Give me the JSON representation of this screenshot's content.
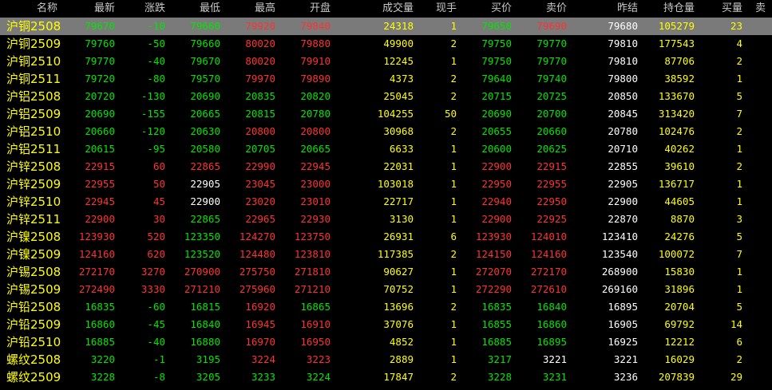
{
  "header": {
    "name": "名称",
    "last": "最新",
    "change": "涨跌",
    "low": "最低",
    "high": "最高",
    "open": "开盘",
    "volume": "成交量",
    "current_hand": "现手",
    "bid": "买价",
    "ask": "卖价",
    "prev_settle": "昨结",
    "open_interest": "持仓量",
    "bid_vol": "买量",
    "ask_vol": "卖"
  },
  "colors": {
    "up": "#ff3232",
    "down": "#00e600",
    "flat": "#ffffff",
    "name": "#ffff00",
    "volume": "#ffff00",
    "selected_row_bg": "#7a7a7a"
  },
  "selected_row": 0,
  "rows": [
    {
      "name": "沪铜2508",
      "last": "79670",
      "chg": "-10",
      "low": "79660",
      "high": "79920",
      "open": "79840",
      "vol": "24318",
      "cur": "1",
      "bid": "79650",
      "ask": "79690",
      "pre": "79680",
      "oi": "105279",
      "bidvol": "23",
      "c": {
        "last": "down",
        "chg": "down",
        "low": "down",
        "high": "up",
        "open": "up",
        "bid": "down",
        "ask": "up"
      }
    },
    {
      "name": "沪铜2509",
      "last": "79760",
      "chg": "-50",
      "low": "79660",
      "high": "80020",
      "open": "79880",
      "vol": "49900",
      "cur": "2",
      "bid": "79750",
      "ask": "79770",
      "pre": "79810",
      "oi": "177543",
      "bidvol": "4",
      "c": {
        "last": "down",
        "chg": "down",
        "low": "down",
        "high": "up",
        "open": "up",
        "bid": "down",
        "ask": "down"
      }
    },
    {
      "name": "沪铜2510",
      "last": "79770",
      "chg": "-40",
      "low": "79670",
      "high": "80020",
      "open": "79910",
      "vol": "12245",
      "cur": "1",
      "bid": "79750",
      "ask": "79770",
      "pre": "79810",
      "oi": "87706",
      "bidvol": "2",
      "c": {
        "last": "down",
        "chg": "down",
        "low": "down",
        "high": "up",
        "open": "up",
        "bid": "down",
        "ask": "down"
      }
    },
    {
      "name": "沪铜2511",
      "last": "79720",
      "chg": "-80",
      "low": "79570",
      "high": "79970",
      "open": "79890",
      "vol": "4373",
      "cur": "2",
      "bid": "79640",
      "ask": "79740",
      "pre": "79800",
      "oi": "38592",
      "bidvol": "1",
      "c": {
        "last": "down",
        "chg": "down",
        "low": "down",
        "high": "up",
        "open": "up",
        "bid": "down",
        "ask": "down"
      }
    },
    {
      "name": "沪铝2508",
      "last": "20720",
      "chg": "-130",
      "low": "20690",
      "high": "20835",
      "open": "20820",
      "vol": "25045",
      "cur": "2",
      "bid": "20715",
      "ask": "20725",
      "pre": "20850",
      "oi": "133670",
      "bidvol": "5",
      "c": {
        "last": "down",
        "chg": "down",
        "low": "down",
        "high": "down",
        "open": "down",
        "bid": "down",
        "ask": "down"
      }
    },
    {
      "name": "沪铝2509",
      "last": "20690",
      "chg": "-155",
      "low": "20665",
      "high": "20815",
      "open": "20780",
      "vol": "104255",
      "cur": "50",
      "bid": "20690",
      "ask": "20700",
      "pre": "20845",
      "oi": "313420",
      "bidvol": "7",
      "c": {
        "last": "down",
        "chg": "down",
        "low": "down",
        "high": "down",
        "open": "down",
        "bid": "down",
        "ask": "down"
      }
    },
    {
      "name": "沪铝2510",
      "last": "20660",
      "chg": "-120",
      "low": "20630",
      "high": "20800",
      "open": "20800",
      "vol": "30968",
      "cur": "2",
      "bid": "20655",
      "ask": "20660",
      "pre": "20780",
      "oi": "102476",
      "bidvol": "2",
      "c": {
        "last": "down",
        "chg": "down",
        "low": "down",
        "high": "up",
        "open": "up",
        "bid": "down",
        "ask": "down"
      }
    },
    {
      "name": "沪铝2511",
      "last": "20615",
      "chg": "-95",
      "low": "20580",
      "high": "20705",
      "open": "20665",
      "vol": "6633",
      "cur": "1",
      "bid": "20600",
      "ask": "20625",
      "pre": "20710",
      "oi": "40262",
      "bidvol": "1",
      "c": {
        "last": "down",
        "chg": "down",
        "low": "down",
        "high": "down",
        "open": "down",
        "bid": "down",
        "ask": "down"
      }
    },
    {
      "name": "沪锌2508",
      "last": "22915",
      "chg": "60",
      "low": "22865",
      "high": "22990",
      "open": "22945",
      "vol": "22031",
      "cur": "1",
      "bid": "22900",
      "ask": "22915",
      "pre": "22855",
      "oi": "39610",
      "bidvol": "2",
      "c": {
        "last": "up",
        "chg": "up",
        "low": "up",
        "high": "up",
        "open": "up",
        "bid": "up",
        "ask": "up"
      }
    },
    {
      "name": "沪锌2509",
      "last": "22955",
      "chg": "50",
      "low": "22905",
      "high": "23045",
      "open": "23000",
      "vol": "103018",
      "cur": "1",
      "bid": "22950",
      "ask": "22955",
      "pre": "22905",
      "oi": "136717",
      "bidvol": "1",
      "c": {
        "last": "up",
        "chg": "up",
        "low": "flat",
        "high": "up",
        "open": "up",
        "bid": "up",
        "ask": "up"
      }
    },
    {
      "name": "沪锌2510",
      "last": "22945",
      "chg": "45",
      "low": "22900",
      "high": "23020",
      "open": "23010",
      "vol": "22717",
      "cur": "1",
      "bid": "22940",
      "ask": "22950",
      "pre": "22900",
      "oi": "44605",
      "bidvol": "1",
      "c": {
        "last": "up",
        "chg": "up",
        "low": "flat",
        "high": "up",
        "open": "up",
        "bid": "up",
        "ask": "up"
      }
    },
    {
      "name": "沪锌2511",
      "last": "22900",
      "chg": "30",
      "low": "22865",
      "high": "22965",
      "open": "22930",
      "vol": "3130",
      "cur": "1",
      "bid": "22900",
      "ask": "22925",
      "pre": "22870",
      "oi": "8870",
      "bidvol": "3",
      "c": {
        "last": "up",
        "chg": "up",
        "low": "down",
        "high": "up",
        "open": "up",
        "bid": "up",
        "ask": "up"
      }
    },
    {
      "name": "沪镍2508",
      "last": "123930",
      "chg": "520",
      "low": "123350",
      "high": "124270",
      "open": "123750",
      "vol": "26931",
      "cur": "6",
      "bid": "123930",
      "ask": "124010",
      "pre": "123410",
      "oi": "24276",
      "bidvol": "5",
      "c": {
        "last": "up",
        "chg": "up",
        "low": "down",
        "high": "up",
        "open": "up",
        "bid": "up",
        "ask": "up"
      }
    },
    {
      "name": "沪镍2509",
      "last": "124160",
      "chg": "620",
      "low": "123520",
      "high": "124480",
      "open": "123810",
      "vol": "117385",
      "cur": "2",
      "bid": "124150",
      "ask": "124160",
      "pre": "123540",
      "oi": "100072",
      "bidvol": "7",
      "c": {
        "last": "up",
        "chg": "up",
        "low": "down",
        "high": "up",
        "open": "up",
        "bid": "up",
        "ask": "up"
      }
    },
    {
      "name": "沪锡2508",
      "last": "272170",
      "chg": "3270",
      "low": "270900",
      "high": "275750",
      "open": "271810",
      "vol": "90627",
      "cur": "1",
      "bid": "272070",
      "ask": "272170",
      "pre": "268900",
      "oi": "15830",
      "bidvol": "1",
      "c": {
        "last": "up",
        "chg": "up",
        "low": "up",
        "high": "up",
        "open": "up",
        "bid": "up",
        "ask": "up"
      }
    },
    {
      "name": "沪锡2509",
      "last": "272490",
      "chg": "3330",
      "low": "271210",
      "high": "275960",
      "open": "271210",
      "vol": "70752",
      "cur": "1",
      "bid": "272290",
      "ask": "272610",
      "pre": "269160",
      "oi": "31896",
      "bidvol": "1",
      "c": {
        "last": "up",
        "chg": "up",
        "low": "up",
        "high": "up",
        "open": "up",
        "bid": "up",
        "ask": "up"
      }
    },
    {
      "name": "沪铅2508",
      "last": "16835",
      "chg": "-60",
      "low": "16815",
      "high": "16920",
      "open": "16865",
      "vol": "13696",
      "cur": "2",
      "bid": "16835",
      "ask": "16840",
      "pre": "16895",
      "oi": "20704",
      "bidvol": "5",
      "c": {
        "last": "down",
        "chg": "down",
        "low": "down",
        "high": "up",
        "open": "down",
        "bid": "down",
        "ask": "down"
      }
    },
    {
      "name": "沪铅2509",
      "last": "16860",
      "chg": "-45",
      "low": "16840",
      "high": "16945",
      "open": "16910",
      "vol": "37076",
      "cur": "1",
      "bid": "16855",
      "ask": "16860",
      "pre": "16905",
      "oi": "69792",
      "bidvol": "14",
      "c": {
        "last": "down",
        "chg": "down",
        "low": "down",
        "high": "up",
        "open": "up",
        "bid": "down",
        "ask": "down"
      }
    },
    {
      "name": "沪铅2510",
      "last": "16885",
      "chg": "-40",
      "low": "16880",
      "high": "16970",
      "open": "16950",
      "vol": "4852",
      "cur": "1",
      "bid": "16885",
      "ask": "16895",
      "pre": "16925",
      "oi": "12212",
      "bidvol": "6",
      "c": {
        "last": "down",
        "chg": "down",
        "low": "down",
        "high": "up",
        "open": "up",
        "bid": "down",
        "ask": "down"
      }
    },
    {
      "name": "螺纹2508",
      "last": "3220",
      "chg": "-1",
      "low": "3195",
      "high": "3224",
      "open": "3223",
      "vol": "2889",
      "cur": "1",
      "bid": "3217",
      "ask": "3221",
      "pre": "3221",
      "oi": "16029",
      "bidvol": "2",
      "c": {
        "last": "down",
        "chg": "down",
        "low": "down",
        "high": "up",
        "open": "up",
        "bid": "down",
        "ask": "flat"
      }
    },
    {
      "name": "螺纹2509",
      "last": "3228",
      "chg": "-8",
      "low": "3205",
      "high": "3233",
      "open": "3224",
      "vol": "17847",
      "cur": "2",
      "bid": "3228",
      "ask": "3231",
      "pre": "3236",
      "oi": "207839",
      "bidvol": "29",
      "c": {
        "last": "down",
        "chg": "down",
        "low": "down",
        "high": "down",
        "open": "down",
        "bid": "down",
        "ask": "down"
      }
    }
  ]
}
